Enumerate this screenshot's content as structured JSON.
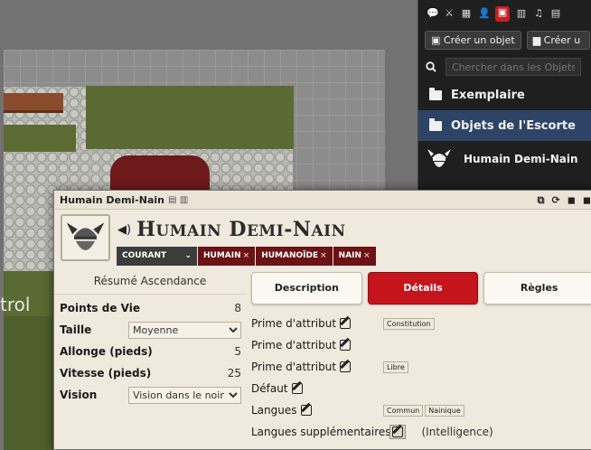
{
  "canvas": {
    "partial_label": "trol"
  },
  "sidebar": {
    "tabs": [
      "chat",
      "combat",
      "scenes",
      "actors",
      "items",
      "journal",
      "playlists",
      "compendium"
    ],
    "active_tab": "items",
    "create_item_label": "Créer un objet",
    "create_folder_label": "Créer u",
    "search_placeholder": "Chercher dans les Objets",
    "folders": [
      {
        "label": "Exemplaire",
        "selected": false
      },
      {
        "label": "Objets de l'Escorte",
        "selected": true
      }
    ],
    "entries": [
      {
        "label": "Humain Demi-Nain",
        "icon": "dwarf-helmet-icon"
      }
    ]
  },
  "sheet": {
    "window_title": "Humain Demi-Nain",
    "item_name_first": "H",
    "item_name_first_rest": "UMAIN",
    "item_name_second": "D",
    "item_name_second_rest": "EMI",
    "item_name_third": "-N",
    "item_name_third_rest": "AIN",
    "rarity": "COURANT",
    "traits": [
      "HUMAIN",
      "HUMANOÏDE",
      "NAIN"
    ],
    "sidebar_title": "Résumé Ascendance",
    "properties": [
      {
        "label": "Points de Vie",
        "value": "8"
      },
      {
        "label": "Taille",
        "value": "Moyenne"
      },
      {
        "label": "Allonge (pieds)",
        "value": "5"
      },
      {
        "label": "Vitesse (pieds)",
        "value": "25"
      },
      {
        "label": "Vision",
        "value": "Vision dans le noir"
      }
    ],
    "tabs": [
      {
        "label": "Description",
        "active": false
      },
      {
        "label": "Détails",
        "active": true
      },
      {
        "label": "Règles",
        "active": false
      }
    ],
    "details": [
      {
        "label": "Prime d'attribut",
        "chips": [
          "Constitution"
        ]
      },
      {
        "label": "Prime d'attribut",
        "chips": []
      },
      {
        "label": "Prime d'attribut",
        "chips": [
          "Libre"
        ]
      },
      {
        "label": "Défaut",
        "chips": []
      },
      {
        "label": "Langues",
        "chips": [
          "Commun",
          "Nainique"
        ]
      }
    ],
    "extra_languages_label": "Langues supplémentaires",
    "extra_languages_note": "(Intelligence)"
  }
}
